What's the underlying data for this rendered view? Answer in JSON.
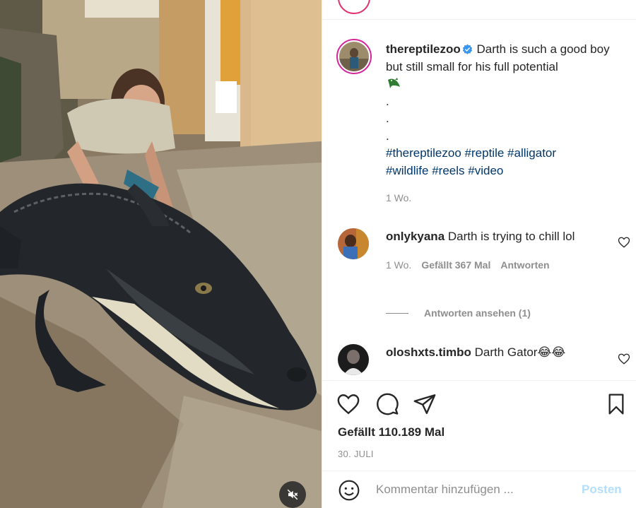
{
  "post": {
    "username": "thereptilezoo",
    "verified": true,
    "caption_text": "Darth is such a good boy but still small for his full potential",
    "caption_emoji": "alligator",
    "dots": [
      ".",
      ".",
      "."
    ],
    "hashtags": [
      "#thereptilezoo",
      "#reptile",
      "#alligator",
      "#wildlife",
      "#reels",
      "#video"
    ],
    "time": "1 Wo."
  },
  "comments": [
    {
      "username": "onlykyana",
      "text": "Darth is trying to chill lol",
      "time": "1 Wo.",
      "likes": "Gefällt 367 Mal",
      "reply_label": "Antworten",
      "view_replies": "Antworten ansehen (1)"
    },
    {
      "username": "oloshxts.timbo",
      "text": "Darth Gator",
      "emoji": "😂😂"
    }
  ],
  "actions": {
    "like_count": "Gefällt 110.189 Mal",
    "date": "30. JULI"
  },
  "comment_box": {
    "placeholder": "Kommentar hinzufügen ...",
    "post_label": "Posten"
  },
  "colors": {
    "link": "#00376b",
    "muted": "#8e8e8e",
    "verified": "#3897f0",
    "post_disabled": "#b2dffc"
  },
  "icons": [
    "heart-icon",
    "comment-icon",
    "share-icon",
    "bookmark-icon",
    "emoji-icon",
    "mute-icon",
    "verified-icon"
  ]
}
